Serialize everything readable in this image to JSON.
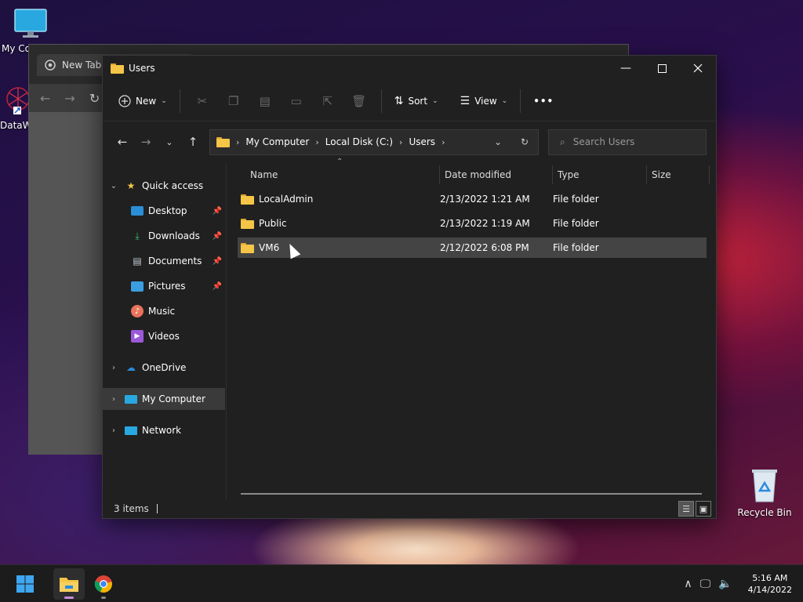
{
  "desktop": {
    "icons": [
      {
        "label": "My Co"
      },
      {
        "label": "DataW"
      },
      {
        "label": "Recycle Bin"
      }
    ]
  },
  "chrome": {
    "tab_label": "New Tab"
  },
  "explorer": {
    "title": "Users",
    "commandbar": {
      "new_label": "New",
      "sort_label": "Sort",
      "view_label": "View",
      "more_label": "•••"
    },
    "address": {
      "crumbs": [
        "My Computer",
        "Local Disk (C:)",
        "Users"
      ]
    },
    "search": {
      "placeholder": "Search Users"
    },
    "navpane": {
      "quick_access": "Quick access",
      "items": [
        "Desktop",
        "Downloads",
        "Documents",
        "Pictures",
        "Music",
        "Videos"
      ],
      "onedrive": "OneDrive",
      "mycomputer": "My Computer",
      "network": "Network"
    },
    "columns": {
      "name": "Name",
      "date": "Date modified",
      "type": "Type",
      "size": "Size"
    },
    "rows": [
      {
        "name": "LocalAdmin",
        "date": "2/13/2022 1:21 AM",
        "type": "File folder"
      },
      {
        "name": "Public",
        "date": "2/13/2022 1:19 AM",
        "type": "File folder"
      },
      {
        "name": "VM6",
        "date": "2/12/2022 6:08 PM",
        "type": "File folder"
      }
    ],
    "status": {
      "count": "3 items"
    }
  },
  "taskbar": {
    "time": "5:16 AM",
    "date": "4/14/2022"
  },
  "colors": {
    "folder": "#f5c547",
    "accent": "#0078d4",
    "selection": "#444444"
  }
}
